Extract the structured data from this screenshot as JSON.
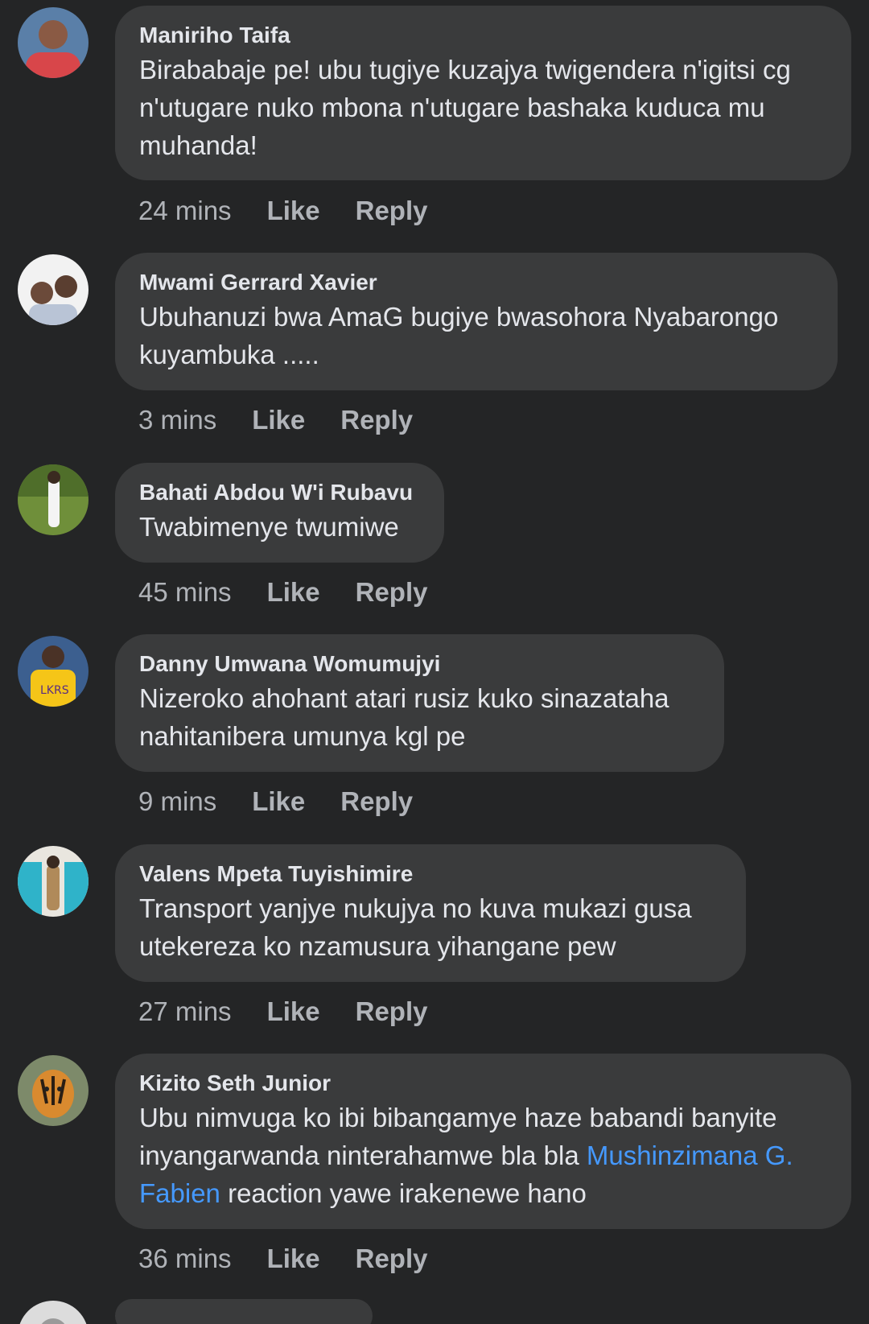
{
  "comments": [
    {
      "author": "Maniriho Taifa",
      "text": "Birababaje pe! ubu tugiye kuzajya twigendera n'igitsi cg n'utugare nuko mbona n'utugare bashaka kuduca mu muhanda!",
      "time": "24 mins",
      "like": "Like",
      "reply": "Reply"
    },
    {
      "author": "Mwami Gerrard Xavier",
      "text": "Ubuhanuzi bwa AmaG bugiye bwasohora Nyabarongo kuyambuka .....",
      "time": "3 mins",
      "like": "Like",
      "reply": "Reply"
    },
    {
      "author": "Bahati Abdou W'i Rubavu",
      "text": "Twabimenye twumiwe",
      "time": "45 mins",
      "like": "Like",
      "reply": "Reply"
    },
    {
      "author": "Danny Umwana Womumujyi",
      "text": "Nizeroko ahohant atari rusiz kuko sinazataha nahitanibera umunya kgl pe",
      "time": "9 mins",
      "like": "Like",
      "reply": "Reply"
    },
    {
      "author": "Valens Mpeta Tuyishimire",
      "text": "Transport yanjye nukujya no kuva mukazi gusa utekereza ko nzamusura yihangane pew",
      "time": "27 mins",
      "like": "Like",
      "reply": "Reply"
    },
    {
      "author": "Kizito Seth Junior",
      "text_before": "Ubu nimvuga ko ibi bibangamye haze babandi banyite inyangarwanda ninterahamwe bla bla ",
      "mention": "Mushinzimana G. Fabien",
      "text_after": " reaction yawe irakenewe hano",
      "time": "36 mins",
      "like": "Like",
      "reply": "Reply"
    }
  ],
  "colors": {
    "background": "#242526",
    "bubble": "#3a3b3c",
    "mention": "#4599ff",
    "meta": "#b0b3b8"
  }
}
